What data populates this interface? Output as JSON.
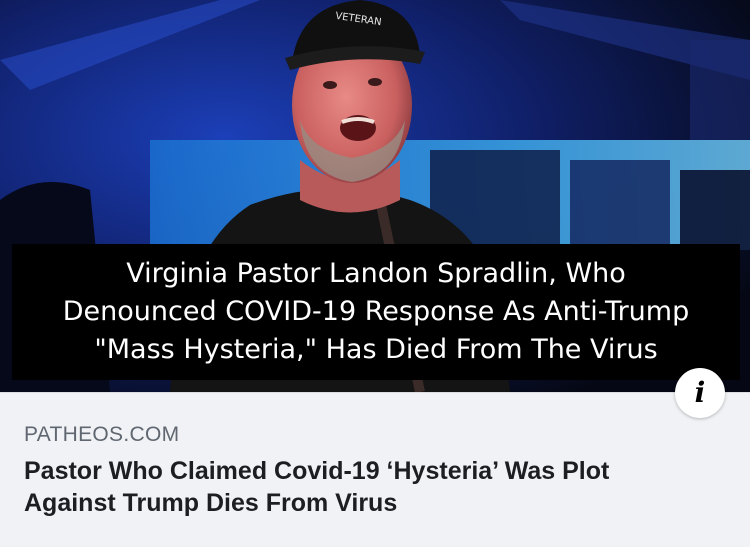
{
  "link_preview": {
    "image": {
      "caption_lines": [
        "Virginia Pastor Landon Spradlin, Who",
        "Denounced COVID-19 Response As Anti-Trump",
        "\"Mass Hysteria,\" Has Died From The Virus"
      ],
      "cap_text": "VETERAN"
    },
    "info_button": {
      "icon": "info-icon",
      "glyph": "i"
    },
    "domain": "PATHEOS.COM",
    "headline_lines": [
      "Pastor Who Claimed Covid-19 ‘Hysteria’ Was Plot",
      "Against Trump Dies From Virus"
    ]
  },
  "colors": {
    "meta_background": "#f0f2f5",
    "domain_text": "#606770",
    "headline_text": "#1c1e21",
    "caption_background": "#000000",
    "caption_text": "#ffffff"
  }
}
